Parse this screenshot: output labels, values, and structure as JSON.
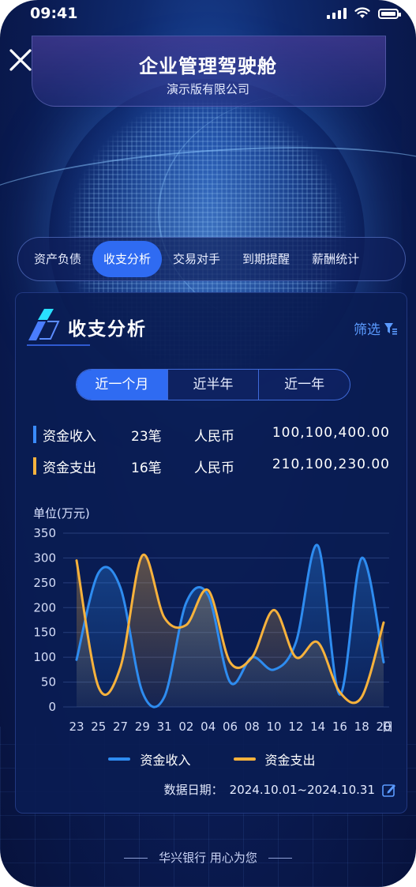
{
  "status": {
    "time": "09:41"
  },
  "header": {
    "title": "企业管理驾驶舱",
    "subtitle": "演示版有限公司"
  },
  "tabs": [
    {
      "label": "资产负债",
      "active": false
    },
    {
      "label": "收支分析",
      "active": true
    },
    {
      "label": "交易对手",
      "active": false
    },
    {
      "label": "到期提醒",
      "active": false
    },
    {
      "label": "薪酬统计",
      "active": false
    }
  ],
  "card": {
    "title": "收支分析",
    "filter_label": "筛选"
  },
  "periods": [
    {
      "label": "近一个月",
      "active": true
    },
    {
      "label": "近半年",
      "active": false
    },
    {
      "label": "近一年",
      "active": false
    }
  ],
  "stats": [
    {
      "label": "资金收入",
      "count": "23笔",
      "currency": "人民币",
      "amount": "100,100,400.00",
      "color": "#3a8bff"
    },
    {
      "label": "资金支出",
      "count": "16笔",
      "currency": "人民币",
      "amount": "210,100,230.00",
      "color": "#f5b23e"
    }
  ],
  "unit_label": "单位(万元)",
  "chart_data": {
    "type": "line",
    "x": [
      "23",
      "25",
      "27",
      "29",
      "31",
      "02",
      "04",
      "06",
      "08",
      "10",
      "12",
      "14",
      "16",
      "18",
      "20"
    ],
    "x_unit": "日",
    "ylim": [
      0,
      350
    ],
    "yticks": [
      0,
      50,
      100,
      150,
      200,
      250,
      300,
      350
    ],
    "series": [
      {
        "name": "资金收入",
        "color": "#2e8cf0",
        "values": [
          95,
          270,
          240,
          30,
          20,
          210,
          225,
          50,
          100,
          75,
          130,
          325,
          25,
          300,
          90
        ]
      },
      {
        "name": "资金支出",
        "color": "#f7b23c",
        "values": [
          295,
          40,
          80,
          305,
          180,
          165,
          235,
          90,
          100,
          195,
          100,
          130,
          30,
          20,
          170
        ]
      }
    ],
    "grid": true,
    "legend": "bottom"
  },
  "date_label": "数据日期：",
  "date_range": "2024.10.01~2024.10.31",
  "footer": "华兴银行 用心为您"
}
